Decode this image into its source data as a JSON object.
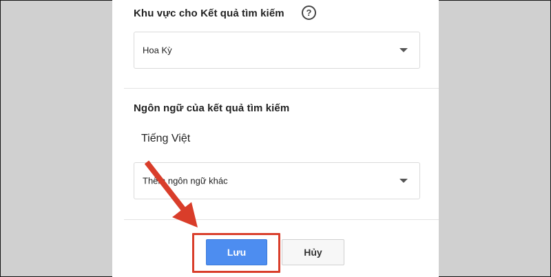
{
  "region_section": {
    "heading": "Khu vực cho Kết quả tìm kiếm",
    "help_icon_glyph": "?",
    "select_value": "Hoa Kỳ"
  },
  "language_section": {
    "heading": "Ngôn ngữ của kết quả tìm kiếm",
    "current_language": "Tiếng Việt",
    "add_language_placeholder": "Thêm ngôn ngữ khác"
  },
  "actions": {
    "save_label": "Lưu",
    "cancel_label": "Hủy"
  },
  "annotation": {
    "color": "#d93d2a"
  }
}
